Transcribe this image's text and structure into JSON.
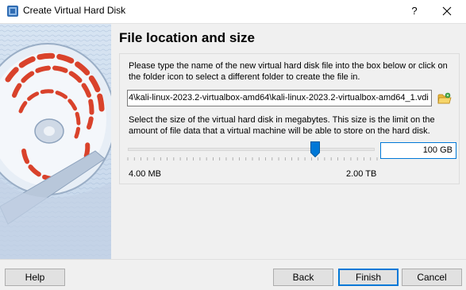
{
  "window": {
    "title": "Create Virtual Hard Disk",
    "help_glyph": "?"
  },
  "page": {
    "heading": "File location and size"
  },
  "location": {
    "description": "Please type the name of the new virtual hard disk file into the box below or click on the folder icon to select a different folder to create the file in.",
    "path_value": "4\\kali-linux-2023.2-virtualbox-amd64\\kali-linux-2023.2-virtualbox-amd64_1.vdi"
  },
  "size": {
    "description": "Select the size of the virtual hard disk in megabytes. This size is the limit on the amount of file data that a virtual machine will be able to store on the hard disk.",
    "value": "100 GB",
    "min_label": "4.00 MB",
    "max_label": "2.00 TB",
    "slider_fraction": 0.76
  },
  "buttons": {
    "help": "Help",
    "back": "Back",
    "finish": "Finish",
    "cancel": "Cancel"
  },
  "colors": {
    "accent": "#0078d7",
    "art_red": "#d9422b",
    "folder_yellow": "#e9b63b"
  }
}
